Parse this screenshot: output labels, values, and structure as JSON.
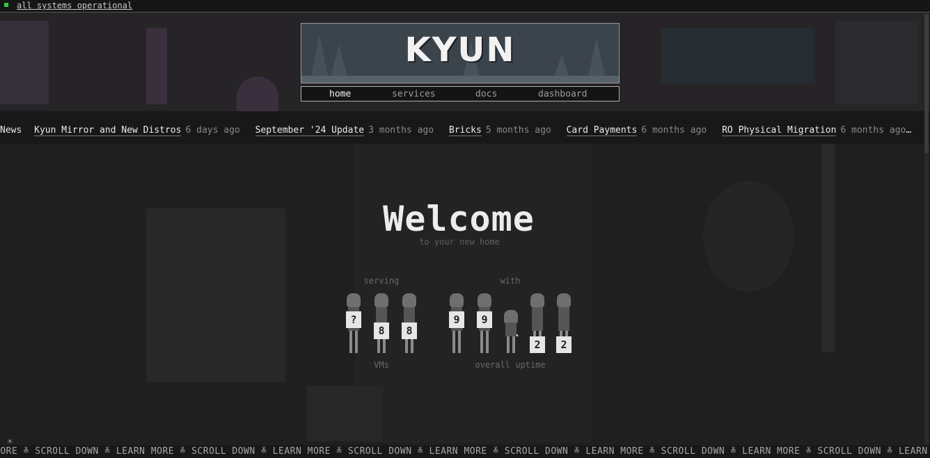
{
  "status": {
    "text": "all systems operational",
    "color": "#2ecc40"
  },
  "logo": {
    "text": "KYUN"
  },
  "nav": {
    "items": [
      {
        "label": "home",
        "active": true
      },
      {
        "label": "services"
      },
      {
        "label": "docs"
      },
      {
        "label": "dashboard"
      }
    ]
  },
  "news": {
    "label": "News",
    "items": [
      {
        "title": "Kyun Mirror and New Distros",
        "time": "6 days ago"
      },
      {
        "title": "September '24 Update",
        "time": "3 months ago"
      },
      {
        "title": "Bricks",
        "time": "5 months ago"
      },
      {
        "title": "Card Payments",
        "time": "6 months ago"
      },
      {
        "title": "RO Physical Migration",
        "time": "6 months ago…"
      }
    ]
  },
  "hero": {
    "title": "Welcome",
    "subtitle": "to your new home"
  },
  "stats": {
    "serving": {
      "label_top": "serving",
      "digits": [
        "?",
        "8",
        "8"
      ],
      "label_bottom": "VMs"
    },
    "with": {
      "label_top": "with",
      "digits": [
        "9",
        "9",
        ".",
        "2",
        "2"
      ],
      "label_bottom": "overall uptime"
    }
  },
  "ticker": {
    "text": "MORE ≚ SCROLL DOWN ≚ LEARN MORE ≚ SCROLL DOWN ≚ LEARN MORE ≚ SCROLL DOWN ≚ LEARN MORE ≚ SCROLL DOWN ≚ LEARN MORE ≚ SCROLL DOWN ≚ LEARN MORE ≚ SCROLL DOWN ≚ LEARN MORE"
  },
  "theme_toggle": {
    "icon": "sun-icon",
    "glyph": "☀"
  }
}
